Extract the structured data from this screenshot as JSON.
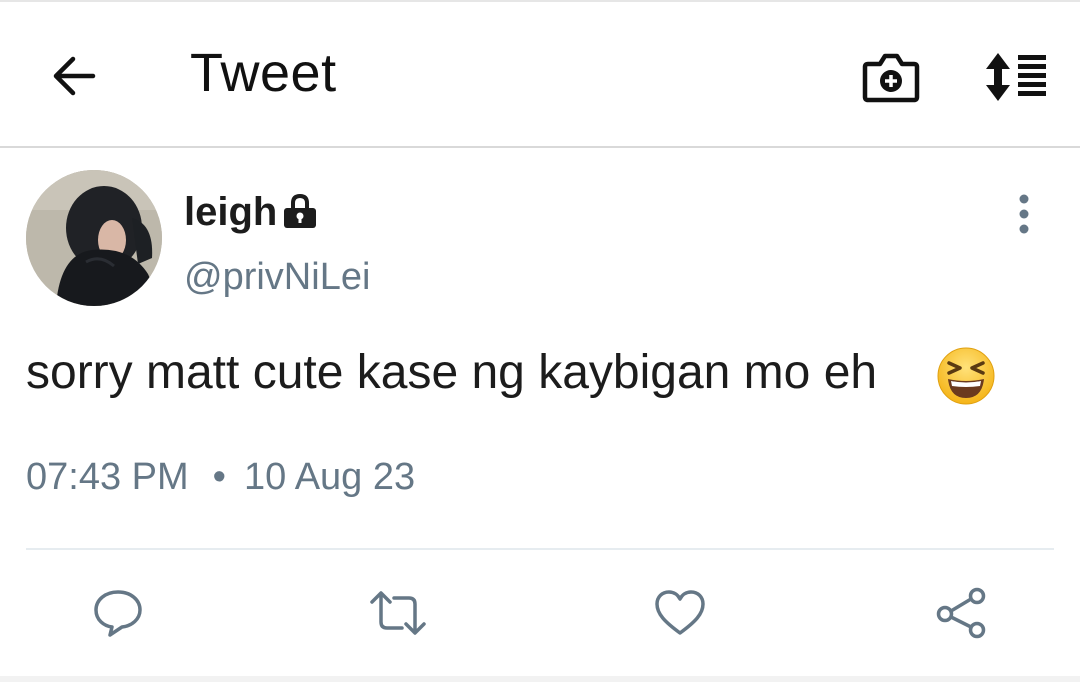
{
  "header": {
    "title": "Tweet",
    "back_icon": "arrow-left-icon",
    "camera_icon": "camera-plus-icon",
    "sort_icon": "sort-list-icon"
  },
  "tweet": {
    "author_name": "leigh",
    "author_handle": "@privNiLei",
    "protected_icon": "lock-icon",
    "more_icon": "more-vertical-icon",
    "text": "sorry matt cute kase ng kaybigan mo eh",
    "emoji": "grinning-squinting-face-emoji",
    "time": "07:43 PM",
    "separator": "•",
    "date": "10 Aug 23"
  },
  "actions": [
    {
      "icon": "reply-icon"
    },
    {
      "icon": "retweet-icon"
    },
    {
      "icon": "heart-icon"
    },
    {
      "icon": "share-icon"
    }
  ],
  "colors": {
    "primary_text": "#1c1c1c",
    "secondary_text": "#657786",
    "divider": "#e6ecf0",
    "icon": "#657786"
  }
}
